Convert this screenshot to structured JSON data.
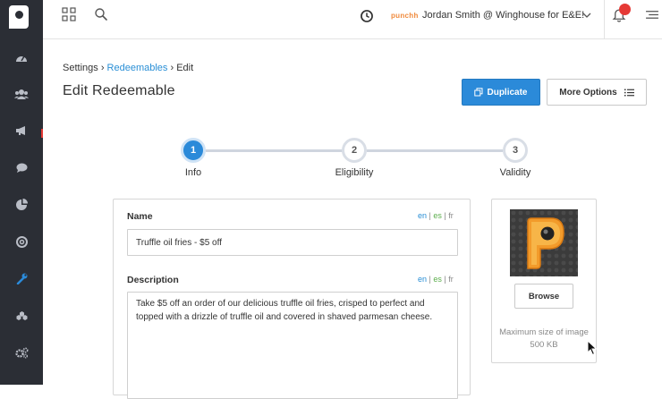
{
  "topbar": {
    "brand_mark": "punchh",
    "user_label": "Jordan Smith @ Winghouse for E&E!"
  },
  "sidebar": {
    "items": [
      {
        "icon": "dashboard-icon"
      },
      {
        "icon": "guests-icon"
      },
      {
        "icon": "campaigns-icon"
      },
      {
        "icon": "messages-icon"
      },
      {
        "icon": "reports-icon"
      },
      {
        "icon": "support-icon"
      },
      {
        "icon": "tools-icon",
        "active": true
      },
      {
        "icon": "integrations-icon"
      },
      {
        "icon": "settings-icon"
      }
    ]
  },
  "breadcrumb": {
    "root": "Settings",
    "sep1": "›",
    "parent": "Redeemables",
    "sep2": "›",
    "current": "Edit"
  },
  "page": {
    "title": "Edit Redeemable",
    "duplicate_label": "Duplicate",
    "more_options_label": "More Options"
  },
  "stepper": {
    "steps": [
      {
        "number": "1",
        "label": "Info",
        "active": true
      },
      {
        "number": "2",
        "label": "Eligibility",
        "active": false
      },
      {
        "number": "3",
        "label": "Validity",
        "active": false
      }
    ]
  },
  "form": {
    "name_label": "Name",
    "name_value": "Truffle oil fries - $5 off",
    "description_label": "Description",
    "description_value": "Take $5 off an order of our delicious truffle oil fries, crisped to perfect and topped with a drizzle of truffle oil and covered in shaved parmesan cheese.",
    "lang_en": "en",
    "lang_es": "es",
    "lang_fr": "fr",
    "lang_sep": "|"
  },
  "image_panel": {
    "browse_label": "Browse",
    "help_text": "Maximum size of image 500 KB"
  },
  "colors": {
    "primary": "#2b8ad9",
    "sidebar_bg": "#2b2e35",
    "link": "#2a8fd6",
    "es_green": "#5cae4c",
    "notification": "#e53935",
    "brand_orange": "#f08a3c"
  }
}
